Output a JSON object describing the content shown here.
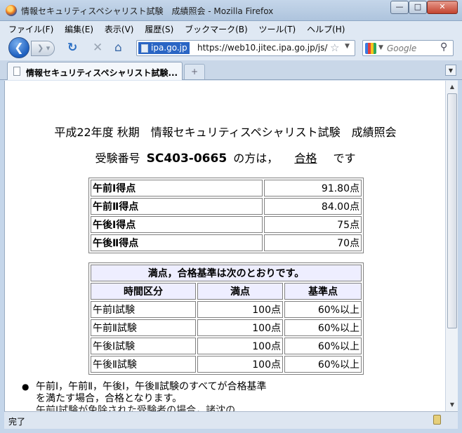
{
  "window": {
    "title": "情報セキュリティスペシャリスト試験　成績照会 - Mozilla Firefox",
    "min_glyph": "—",
    "max_glyph": "□",
    "close_glyph": "✕"
  },
  "menu": {
    "items": [
      {
        "label": "ファイル(F)"
      },
      {
        "label": "編集(E)"
      },
      {
        "label": "表示(V)"
      },
      {
        "label": "履歴(S)"
      },
      {
        "label": "ブックマーク(B)"
      },
      {
        "label": "ツール(T)"
      },
      {
        "label": "ヘルプ(H)"
      }
    ]
  },
  "nav": {
    "back_icon": "back-arrow-icon",
    "site": "ipa.go.jp",
    "url": "https://web10.jitec.ipa.go.jp/js/",
    "search_placeholder": "Google"
  },
  "tabs": [
    {
      "label": "情報セキュリティスペシャリスト試験..."
    }
  ],
  "content": {
    "heading": "平成22年度 秋期　情報セキュリティスペシャリスト試験　成績照会",
    "result_prefix": "受験番号",
    "exam_number": "SC403-0665",
    "result_middle": "の方は，",
    "result_status": "合格",
    "result_suffix": "です",
    "scores": [
      {
        "label": "午前Ⅰ得点",
        "value": "91.80点"
      },
      {
        "label": "午前Ⅱ得点",
        "value": "84.00点"
      },
      {
        "label": "午後Ⅰ得点",
        "value": "75点"
      },
      {
        "label": "午後Ⅱ得点",
        "value": "70点"
      }
    ],
    "criteria": {
      "caption": "満点，合格基準は次のとおりです。",
      "headers": [
        "時間区分",
        "満点",
        "基準点"
      ],
      "rows": [
        {
          "section": "午前Ⅰ試験",
          "full": "100点",
          "base": "60%以上"
        },
        {
          "section": "午前Ⅱ試験",
          "full": "100点",
          "base": "60%以上"
        },
        {
          "section": "午後Ⅰ試験",
          "full": "100点",
          "base": "60%以上"
        },
        {
          "section": "午後Ⅱ試験",
          "full": "100点",
          "base": "60%以上"
        }
      ]
    },
    "note": "午前Ⅰ，午前Ⅱ，午後Ⅰ，午後Ⅱ試験のすべてが合格基準を満たす場合，合格となります。",
    "note_next_partial": "午前Ⅰ試験が免除された受験者の場合，諸沈の"
  },
  "status": {
    "text": "完了"
  }
}
